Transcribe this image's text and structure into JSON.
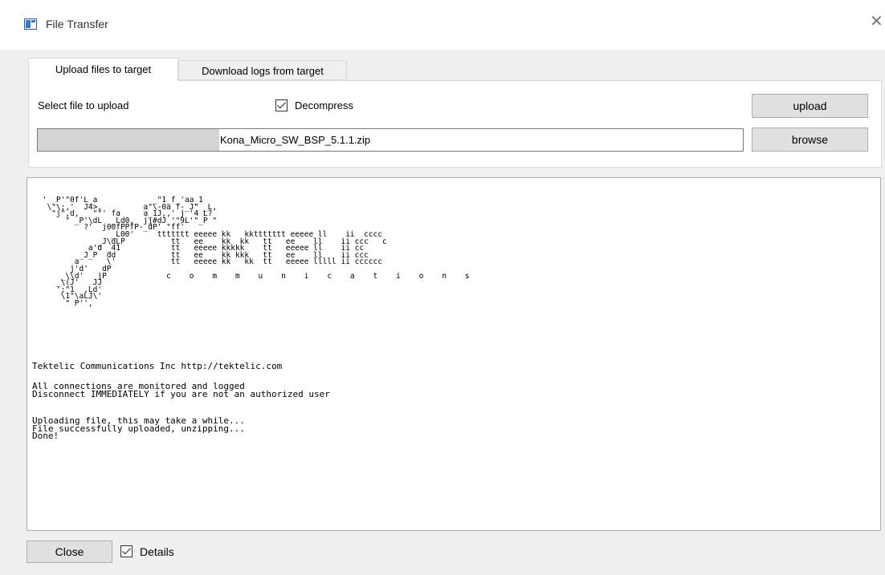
{
  "window": {
    "title": "File Transfer",
    "close_glyph": "✕",
    "icon": "app-window-icon"
  },
  "tabs": [
    {
      "label": "Upload files to target",
      "active": true
    },
    {
      "label": "Download logs from target",
      "active": false
    }
  ],
  "upload": {
    "select_label": "Select file to upload",
    "decompress_label": "Decompress",
    "decompress_checked": true,
    "upload_button": "upload",
    "browse_button": "browse",
    "file_name": "Kona_Micro_SW_BSP_5.1.1.zip"
  },
  "console": {
    "banner_logo": " '  P'\"0f'L_a            _\"1_f_'aa_1\n  \\\"\\;,'  J4>,         a\"\\-0a f-_J\" _L,\n   \"j\",d,   \"\"' fa     a_1J,,' j '4 L?\n      \" _P'\\dL  _Ld0,  jj#dJ '\"9L'\"_P \"\n          ?'  j00fPPfP-_dP' \"ff'\n                _L00'     ttttttt eeeee kk   kkttttttt eeeee ll    ii  cccc\n             _J\\dLP          tt   ee    kk  kk   tt   ee    ll    ii ccc   c\n           a'd _41           tt   eeeee kkkkk    tt   eeeee ll    ii cc\n         _J_P  dd            tt   ee    kk kkk   tt   ee    ll    ii ccc\n        a      \\'            tt   eeeee kk   kk  tt   eeeee lllll ii cccccc\n       j'd'   dP\n     _\\\\d'   jP             c    o    m    m    u    n    i    c    a    t    i    o    n    s\n    _\\(J'   JJ\n    ';\"1  ,Ld'\n     \\1\"\\aLJ\\'\n      \" P'',",
    "company_line": "Tektelic Communications Inc http://tektelic.com",
    "warning_lines": "All connections are monitored and logged\nDisconnect IMMEDIATELY if you are not an authorized user",
    "status_lines": "Uploading file, this may take a while...\nFile successfully uploaded, unzipping...\nDone!"
  },
  "footer": {
    "close_button": "Close",
    "details_label": "Details",
    "details_checked": true
  }
}
